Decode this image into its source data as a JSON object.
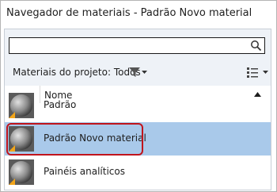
{
  "window": {
    "title": "Navegador de materiais - Padrão Novo material"
  },
  "search": {
    "value": "",
    "placeholder": ""
  },
  "filter": {
    "label": "Materiais do projeto: Todos"
  },
  "list": {
    "column_header": "Nome",
    "rows": [
      {
        "label": "Padrão",
        "selected": false
      },
      {
        "label": "Padrão Novo material",
        "selected": true
      },
      {
        "label": "Painéis analíticos",
        "selected": false
      }
    ]
  },
  "colors": {
    "selection": "#a9c9ea",
    "highlight_frame": "#c0141c",
    "panel_bg": "#eef2f7",
    "badge": "#f2a51a"
  },
  "icons": [
    "search-icon",
    "filter-funnel-icon",
    "list-view-icon",
    "sort-up-icon",
    "material-sphere-icon"
  ]
}
